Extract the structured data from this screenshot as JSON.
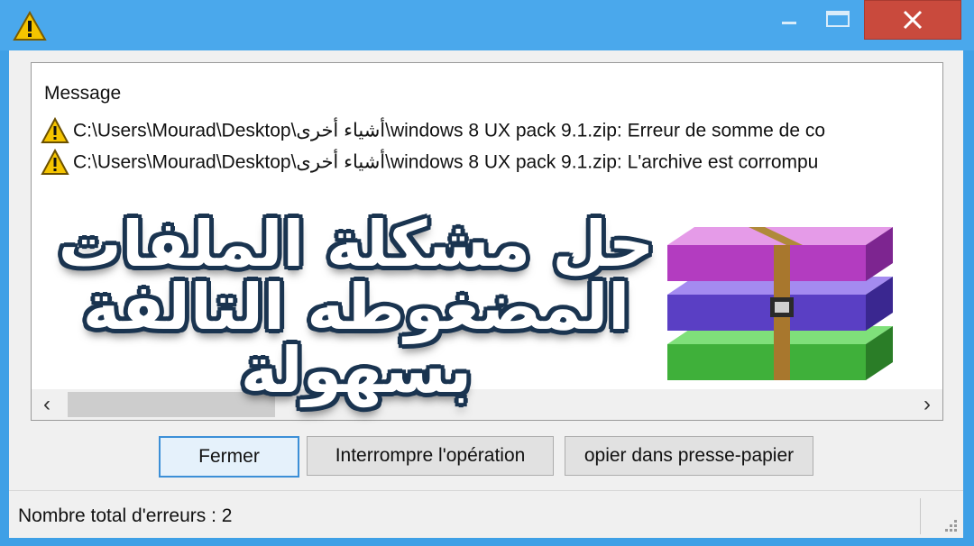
{
  "window": {
    "title": "",
    "close_icon": "close-icon",
    "maximize_icon": "maximize-icon",
    "minimize_icon": "minimize-icon",
    "close_color": "#c94a3d"
  },
  "list": {
    "column_header": "Message",
    "rows": [
      {
        "icon": "warning-icon",
        "text": "C:\\Users\\Mourad\\Desktop\\أشياء أخرى\\windows 8 UX pack 9.1.zip: Erreur de somme de co"
      },
      {
        "icon": "warning-icon",
        "text": "C:\\Users\\Mourad\\Desktop\\أشياء أخرى\\windows 8 UX pack 9.1.zip: L'archive est corrompu"
      }
    ]
  },
  "overlay": {
    "line1": "حل مشكلة الملفات",
    "line2": "المضغوطه التالفة",
    "line3": "بسهولة"
  },
  "buttons": {
    "close_label": "Fermer",
    "abort_label": "Interrompre l'opération",
    "copy_label": "opier dans presse-papier"
  },
  "status": {
    "error_count_text": "Nombre total d'erreurs : 2"
  },
  "colors": {
    "accent": "#3fa0e6",
    "warning": "#f5c400"
  }
}
